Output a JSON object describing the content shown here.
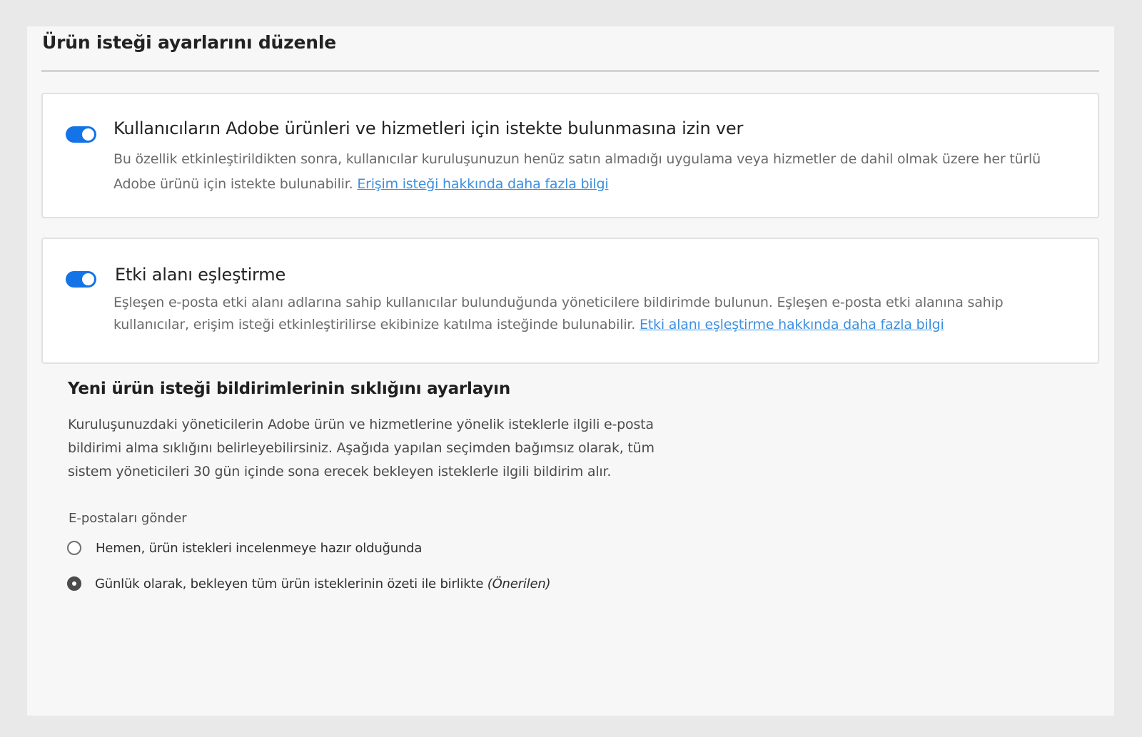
{
  "page": {
    "title": "Ürün isteği ayarlarını düzenle"
  },
  "access_request": {
    "enabled": true,
    "title": "Kullanıcıların Adobe ürünleri ve hizmetleri için istekte bulunmasına izin ver",
    "description": "Bu özellik etkinleştirildikten sonra, kullanıcılar kuruluşunuzun henüz satın almadığı uygulama veya hizmetler de dahil olmak üzere her türlü Adobe ürünü için istekte bulunabilir.",
    "link_label": "Erişim isteği hakkında daha fazla bilgi"
  },
  "domain_matching": {
    "enabled": true,
    "title": "Etki alanı eşleştirme",
    "description": "Eşleşen e-posta etki alanı adlarına sahip kullanıcılar bulunduğunda yöneticilere bildirimde bulunun. Eşleşen e-posta etki alanına sahip kullanıcılar, erişim isteği etkinleştirilirse ekibinize katılma isteğinde bulunabilir.",
    "link_label": "Etki alanı eşleştirme hakkında daha fazla bilgi"
  },
  "notifications": {
    "title": "Yeni ürün isteği bildirimlerinin sıklığını ayarlayın",
    "description": "Kuruluşunuzdaki yöneticilerin Adobe ürün ve hizmetlerine yönelik isteklerle ilgili e-posta bildirimi alma sıklığını belirleyebilirsiniz. Aşağıda yapılan seçimden bağımsız olarak, tüm sistem yöneticileri 30 gün içinde sona erecek bekleyen isteklerle ilgili bildirim alır.",
    "send_label": "E-postaları gönder",
    "options": [
      {
        "label": "Hemen, ürün istekleri incelenmeye hazır olduğunda",
        "suffix": "",
        "selected": false
      },
      {
        "label": "Günlük olarak, bekleyen tüm ürün isteklerinin özeti ile birlikte",
        "suffix": "(Önerilen)",
        "selected": true
      }
    ]
  },
  "colors": {
    "toggle_on": "#1473e6",
    "link": "#3d8fe0",
    "panel_bg": "#f7f7f7",
    "page_bg": "#e9e9e9"
  }
}
